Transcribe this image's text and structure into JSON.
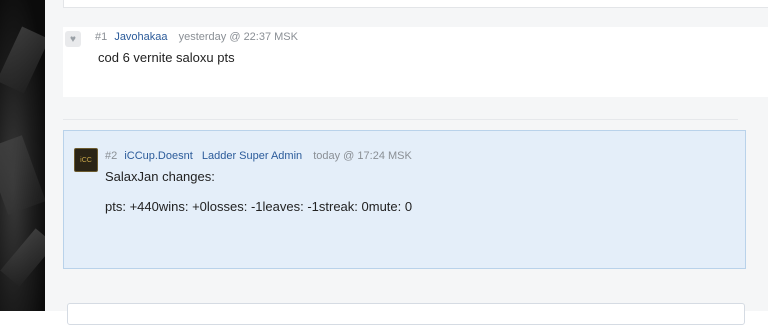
{
  "posts": [
    {
      "number": "#1",
      "username": "Javohakaa",
      "timestamp": "yesterday @ 22:37 MSK",
      "message": "cod 6 vernite saloxu pts",
      "avatar_icon": "heart-icon"
    },
    {
      "number": "#2",
      "username": "iCCup.Doesnt",
      "role": "Ladder Super Admin",
      "timestamp": "today @ 17:24 MSK",
      "lines": [
        "SalaxJan changes:",
        "pts: +440wins: +0losses: -1leaves: -1streak: 0mute: 0"
      ],
      "avatar_icon": "user-avatar-icon"
    }
  ],
  "colors": {
    "link": "#2b5b9a",
    "meta": "#8a8f95",
    "highlight_bg": "#e4eef9",
    "highlight_border": "#b9d2ea"
  }
}
